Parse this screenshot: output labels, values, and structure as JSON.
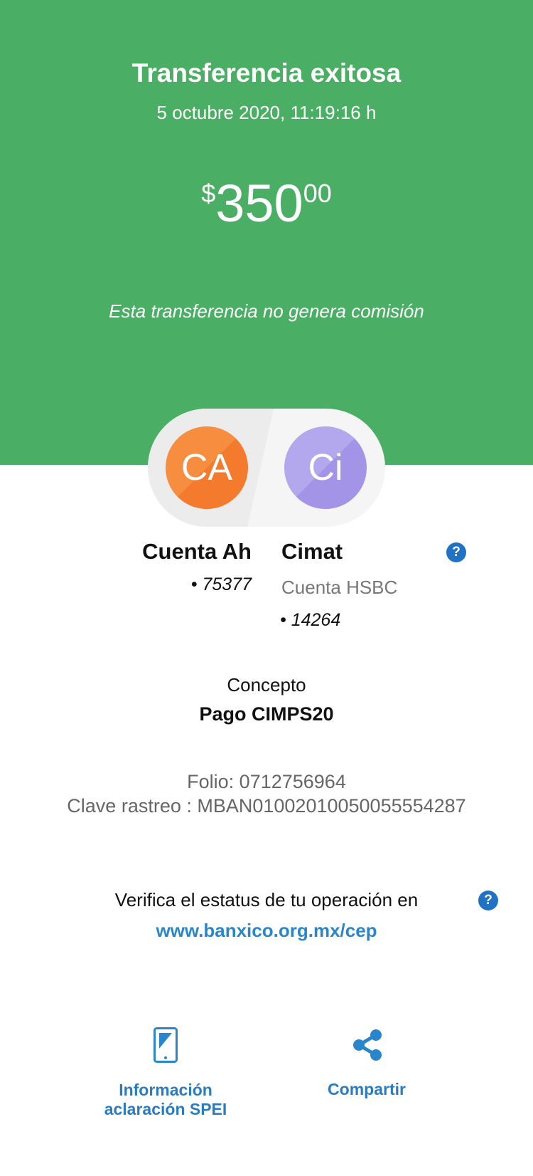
{
  "header": {
    "title": "Transferencia exitosa",
    "datetime": "5 octubre 2020, 11:19:16 h",
    "amount": {
      "currency": "$",
      "integer": "350",
      "cents": "00"
    },
    "note": "Esta transferencia no genera comisión",
    "bg_color": "#4aae64"
  },
  "origin": {
    "initials": "CA",
    "name": "Cuenta Ah",
    "account": "• 75377",
    "color": "#f47a2e"
  },
  "destination": {
    "initials": "Ci",
    "name": "Cimat",
    "bank": "Cuenta HSBC",
    "account": "• 14264",
    "color": "#a394e8"
  },
  "help_icon": "?",
  "concept": {
    "label": "Concepto",
    "value": "Pago CIMPS20"
  },
  "references": {
    "folio": "Folio: 0712756964",
    "tracking": "Clave rastreo : MBAN01002010050055554287"
  },
  "verify": {
    "text": "Verifica el estatus de tu operación en",
    "link": "www.banxico.org.mx/cep"
  },
  "actions": [
    {
      "icon": "tablet-icon",
      "line1": "Información",
      "line2": "aclaración SPEI"
    },
    {
      "icon": "share-icon",
      "label": "Compartir"
    }
  ]
}
